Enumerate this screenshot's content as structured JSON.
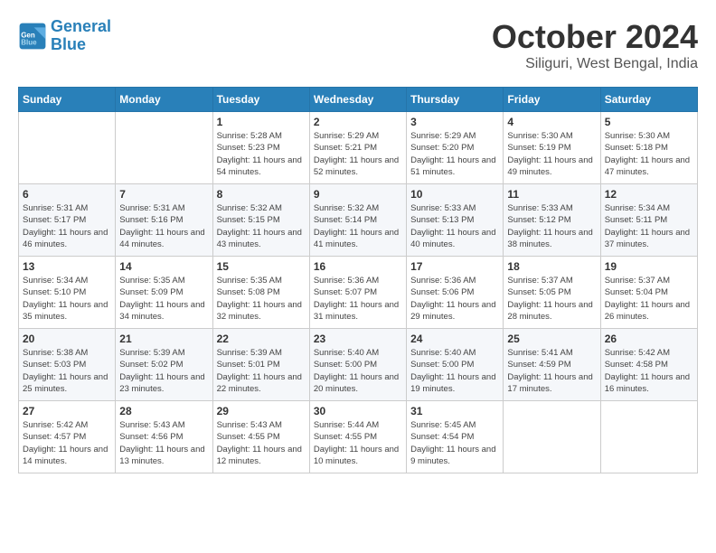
{
  "header": {
    "logo_line1": "General",
    "logo_line2": "Blue",
    "month_title": "October 2024",
    "location": "Siliguri, West Bengal, India"
  },
  "weekdays": [
    "Sunday",
    "Monday",
    "Tuesday",
    "Wednesday",
    "Thursday",
    "Friday",
    "Saturday"
  ],
  "weeks": [
    [
      {
        "day": "",
        "info": ""
      },
      {
        "day": "",
        "info": ""
      },
      {
        "day": "1",
        "info": "Sunrise: 5:28 AM\nSunset: 5:23 PM\nDaylight: 11 hours and 54 minutes."
      },
      {
        "day": "2",
        "info": "Sunrise: 5:29 AM\nSunset: 5:21 PM\nDaylight: 11 hours and 52 minutes."
      },
      {
        "day": "3",
        "info": "Sunrise: 5:29 AM\nSunset: 5:20 PM\nDaylight: 11 hours and 51 minutes."
      },
      {
        "day": "4",
        "info": "Sunrise: 5:30 AM\nSunset: 5:19 PM\nDaylight: 11 hours and 49 minutes."
      },
      {
        "day": "5",
        "info": "Sunrise: 5:30 AM\nSunset: 5:18 PM\nDaylight: 11 hours and 47 minutes."
      }
    ],
    [
      {
        "day": "6",
        "info": "Sunrise: 5:31 AM\nSunset: 5:17 PM\nDaylight: 11 hours and 46 minutes."
      },
      {
        "day": "7",
        "info": "Sunrise: 5:31 AM\nSunset: 5:16 PM\nDaylight: 11 hours and 44 minutes."
      },
      {
        "day": "8",
        "info": "Sunrise: 5:32 AM\nSunset: 5:15 PM\nDaylight: 11 hours and 43 minutes."
      },
      {
        "day": "9",
        "info": "Sunrise: 5:32 AM\nSunset: 5:14 PM\nDaylight: 11 hours and 41 minutes."
      },
      {
        "day": "10",
        "info": "Sunrise: 5:33 AM\nSunset: 5:13 PM\nDaylight: 11 hours and 40 minutes."
      },
      {
        "day": "11",
        "info": "Sunrise: 5:33 AM\nSunset: 5:12 PM\nDaylight: 11 hours and 38 minutes."
      },
      {
        "day": "12",
        "info": "Sunrise: 5:34 AM\nSunset: 5:11 PM\nDaylight: 11 hours and 37 minutes."
      }
    ],
    [
      {
        "day": "13",
        "info": "Sunrise: 5:34 AM\nSunset: 5:10 PM\nDaylight: 11 hours and 35 minutes."
      },
      {
        "day": "14",
        "info": "Sunrise: 5:35 AM\nSunset: 5:09 PM\nDaylight: 11 hours and 34 minutes."
      },
      {
        "day": "15",
        "info": "Sunrise: 5:35 AM\nSunset: 5:08 PM\nDaylight: 11 hours and 32 minutes."
      },
      {
        "day": "16",
        "info": "Sunrise: 5:36 AM\nSunset: 5:07 PM\nDaylight: 11 hours and 31 minutes."
      },
      {
        "day": "17",
        "info": "Sunrise: 5:36 AM\nSunset: 5:06 PM\nDaylight: 11 hours and 29 minutes."
      },
      {
        "day": "18",
        "info": "Sunrise: 5:37 AM\nSunset: 5:05 PM\nDaylight: 11 hours and 28 minutes."
      },
      {
        "day": "19",
        "info": "Sunrise: 5:37 AM\nSunset: 5:04 PM\nDaylight: 11 hours and 26 minutes."
      }
    ],
    [
      {
        "day": "20",
        "info": "Sunrise: 5:38 AM\nSunset: 5:03 PM\nDaylight: 11 hours and 25 minutes."
      },
      {
        "day": "21",
        "info": "Sunrise: 5:39 AM\nSunset: 5:02 PM\nDaylight: 11 hours and 23 minutes."
      },
      {
        "day": "22",
        "info": "Sunrise: 5:39 AM\nSunset: 5:01 PM\nDaylight: 11 hours and 22 minutes."
      },
      {
        "day": "23",
        "info": "Sunrise: 5:40 AM\nSunset: 5:00 PM\nDaylight: 11 hours and 20 minutes."
      },
      {
        "day": "24",
        "info": "Sunrise: 5:40 AM\nSunset: 5:00 PM\nDaylight: 11 hours and 19 minutes."
      },
      {
        "day": "25",
        "info": "Sunrise: 5:41 AM\nSunset: 4:59 PM\nDaylight: 11 hours and 17 minutes."
      },
      {
        "day": "26",
        "info": "Sunrise: 5:42 AM\nSunset: 4:58 PM\nDaylight: 11 hours and 16 minutes."
      }
    ],
    [
      {
        "day": "27",
        "info": "Sunrise: 5:42 AM\nSunset: 4:57 PM\nDaylight: 11 hours and 14 minutes."
      },
      {
        "day": "28",
        "info": "Sunrise: 5:43 AM\nSunset: 4:56 PM\nDaylight: 11 hours and 13 minutes."
      },
      {
        "day": "29",
        "info": "Sunrise: 5:43 AM\nSunset: 4:55 PM\nDaylight: 11 hours and 12 minutes."
      },
      {
        "day": "30",
        "info": "Sunrise: 5:44 AM\nSunset: 4:55 PM\nDaylight: 11 hours and 10 minutes."
      },
      {
        "day": "31",
        "info": "Sunrise: 5:45 AM\nSunset: 4:54 PM\nDaylight: 11 hours and 9 minutes."
      },
      {
        "day": "",
        "info": ""
      },
      {
        "day": "",
        "info": ""
      }
    ]
  ]
}
